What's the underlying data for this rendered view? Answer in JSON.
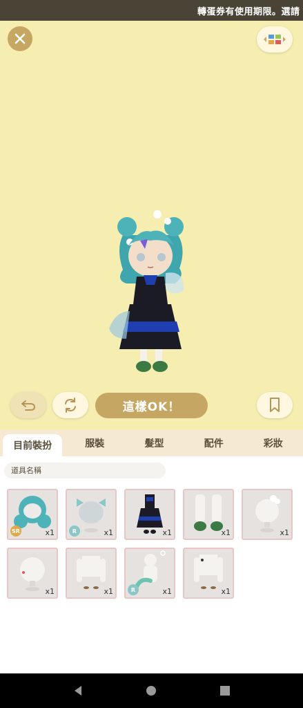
{
  "status_bar": {
    "ticker": "轉蛋券有使用期限。選請"
  },
  "buttons": {
    "ok_label": "這樣OK！"
  },
  "tabs": [
    {
      "label": "目前裝扮",
      "active": true
    },
    {
      "label": "服裝",
      "active": false
    },
    {
      "label": "髮型",
      "active": false
    },
    {
      "label": "配件",
      "active": false
    },
    {
      "label": "彩妝",
      "active": false
    }
  ],
  "item_name_field": {
    "placeholder": "道具名稱"
  },
  "items": [
    {
      "name": "hair-teal-curly",
      "rarity": "SR",
      "qty": "x1"
    },
    {
      "name": "hair-teal-bow",
      "rarity": "R",
      "qty": "x1"
    },
    {
      "name": "outfit-black-blue-dress",
      "rarity": "",
      "qty": "x1"
    },
    {
      "name": "shoes-green-boots",
      "rarity": "",
      "qty": "x1"
    },
    {
      "name": "hair-accessory-flowers",
      "rarity": "",
      "qty": "x1"
    },
    {
      "name": "face-accessory",
      "rarity": "",
      "qty": "x1"
    },
    {
      "name": "arm-accessory",
      "rarity": "",
      "qty": "x1"
    },
    {
      "name": "tail-accessory",
      "rarity": "R",
      "qty": "x1"
    },
    {
      "name": "tattoo-accessory",
      "rarity": "",
      "qty": "x1"
    }
  ],
  "colors": {
    "accent": "#c6a663",
    "stage_bg": "#f6eeb0",
    "tab_bg": "#f5e9d3"
  }
}
